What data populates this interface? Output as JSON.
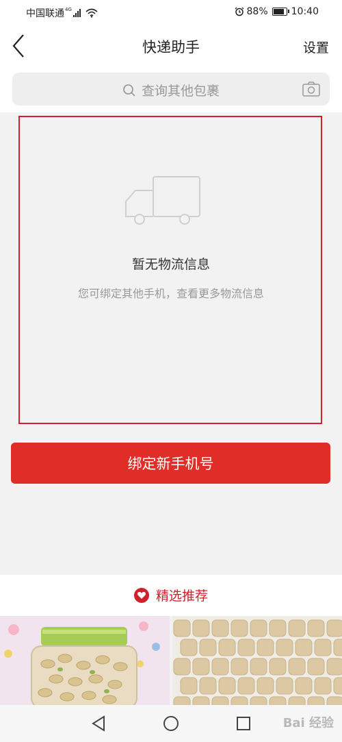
{
  "status_bar": {
    "carrier": "中国联通",
    "network": "4G",
    "battery": "88%",
    "time": "10:40",
    "battery_level": 0.88
  },
  "header": {
    "back_icon": "chevron-left-icon",
    "title": "快递助手",
    "settings_label": "设置"
  },
  "search": {
    "placeholder": "查询其他包裹",
    "search_icon": "search-icon",
    "camera_icon": "camera-icon"
  },
  "empty_state": {
    "icon": "truck-icon",
    "title": "暂无物流信息",
    "subtitle": "您可绑定其他手机，查看更多物流信息",
    "highlight_color": "#d0202a"
  },
  "bind_button": {
    "label": "绑定新手机号",
    "color": "#e02d27"
  },
  "recommend": {
    "title": "精选推荐",
    "icon": "heart-icon",
    "products": [
      {
        "image": "pistachio-jar-image"
      },
      {
        "image": "paper-rolls-image"
      }
    ]
  },
  "nav_bar": {
    "back_icon": "triangle-back-icon",
    "home_icon": "circle-home-icon",
    "recent_icon": "square-recent-icon",
    "watermark": "Bai 经验"
  }
}
